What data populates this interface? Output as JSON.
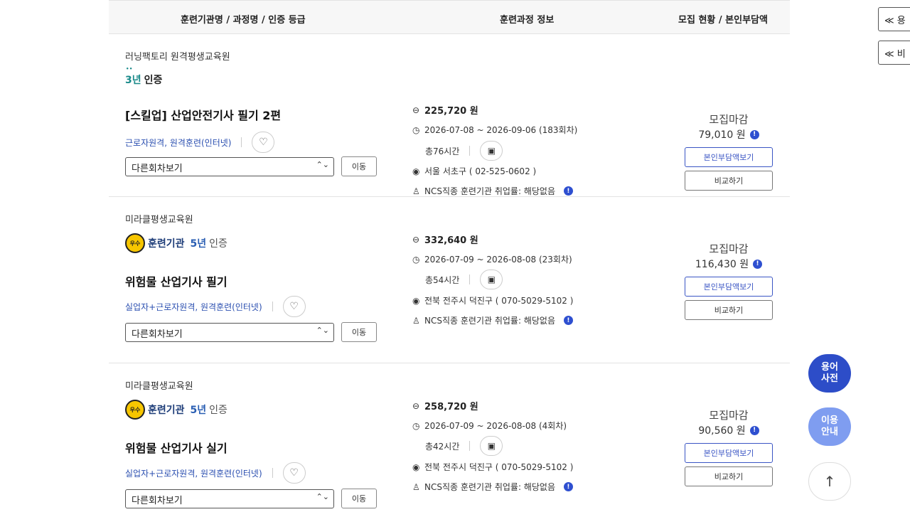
{
  "header": {
    "col1": "훈련기관명 / 과정명 / 인증 등급",
    "col2": "훈련과정 정보",
    "col3": "모집 현황 / 본인부담액"
  },
  "side_tabs": [
    "≪ 용",
    "≪ 비"
  ],
  "float": {
    "dict": "용어\n사전",
    "guide": "이용\n안내",
    "top": "↑"
  },
  "courses": [
    {
      "institution": "러닝팩토리 원격평생교육원",
      "cert_years": "3년",
      "cert_label": "인증",
      "title": "[스킬업] 산업안전기사 필기 2편",
      "tags": "근로자원격, 원격훈련(인터넷)",
      "select": "다른회차보기",
      "move": "이동",
      "price": "225,720 원",
      "period": "2026-07-08 ~ 2026-09-06 (183회차)",
      "hours": "총76시간",
      "location": "서울 서초구 ( 02-525-0602 )",
      "employment": "NCS직종 훈련기관 취업률: 해당없음",
      "status": "모집마감",
      "fee": "79,010 원",
      "selfpay_btn": "본인부담액보기",
      "compare_btn": "비교하기"
    },
    {
      "institution": "미라클평생교육원",
      "badge_circle": "우수",
      "badge_text": "훈련기관",
      "cert_years": "5년",
      "cert_label": "인증",
      "title": "위험물 산업기사 필기",
      "tags": "실업자+근로자원격, 원격훈련(인터넷)",
      "select": "다른회차보기",
      "move": "이동",
      "price": "332,640 원",
      "period": "2026-07-09 ~ 2026-08-08 (23회차)",
      "hours": "총54시간",
      "location": "전북 전주시 덕진구 ( 070-5029-5102 )",
      "employment": "NCS직종 훈련기관 취업률: 해당없음",
      "status": "모집마감",
      "fee": "116,430 원",
      "selfpay_btn": "본인부담액보기",
      "compare_btn": "비교하기"
    },
    {
      "institution": "미라클평생교육원",
      "badge_circle": "우수",
      "badge_text": "훈련기관",
      "cert_years": "5년",
      "cert_label": "인증",
      "title": "위험물 산업기사 실기",
      "tags": "실업자+근로자원격, 원격훈련(인터넷)",
      "select": "다른회차보기",
      "move": "이동",
      "price": "258,720 원",
      "period": "2026-07-09 ~ 2026-08-08 (4회차)",
      "hours": "총42시간",
      "location": "전북 전주시 덕진구 ( 070-5029-5102 )",
      "employment": "NCS직종 훈련기관 취업률: 해당없음",
      "status": "모집마감",
      "fee": "90,560 원",
      "selfpay_btn": "본인부담액보기",
      "compare_btn": "비교하기"
    }
  ]
}
